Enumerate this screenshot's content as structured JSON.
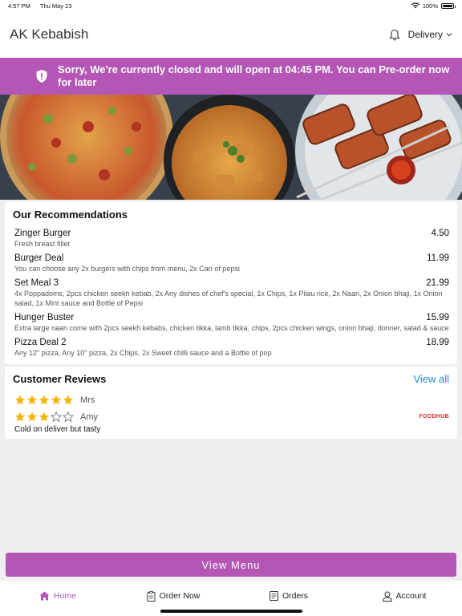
{
  "status_bar": {
    "time": "4:57 PM",
    "date": "Thu May 23",
    "battery": "100%",
    "battery_level": 1.0
  },
  "header": {
    "title": "AK Kebabish",
    "delivery_label": "Delivery"
  },
  "banner": {
    "message": "Sorry, We're currently closed and will open at 04:45 PM. You can Pre-order now for later"
  },
  "recommendations": {
    "title": "Our Recommendations",
    "items": [
      {
        "name": "Zinger Burger",
        "price": "4.50",
        "description": "Fresh breast fillet"
      },
      {
        "name": "Burger Deal",
        "price": "11.99",
        "description": "You can choose any 2x burgers with chips from menu, 2x Can of pepsi"
      },
      {
        "name": "Set Meal 3",
        "price": "21.99",
        "description": "4x Poppadoms, 2pcs chicken seekh kebab, 2x Any dishes of chef's special, 1x Chips, 1x Pilau rice, 2x Naan, 2x Onion bhaji, 1x Onion salad, 1x Mint sauce and Bottle of Pepsi"
      },
      {
        "name": "Hunger Buster",
        "price": "15.99",
        "description": "Extra large naan come with 2pcs seekh kebabs, chicken tikka, lamb tikka, chips, 2pcs chicken wings, onion bhaji, donner, salad & sauce"
      },
      {
        "name": "Pizza Deal 2",
        "price": "18.99",
        "description": "Any 12\" pizza, Any 10\" pizza, 2x Chips, 2x Sweet chilli sauce and a Bottle of pop"
      }
    ]
  },
  "reviews": {
    "title": "Customer Reviews",
    "view_all_label": "View all",
    "items": [
      {
        "reviewer": "Mrs",
        "rating": 5,
        "text": ""
      },
      {
        "reviewer": "Amy",
        "rating": 3,
        "text": "Cold on deliver but tasty",
        "source": "FOODHUB"
      }
    ]
  },
  "view_menu_label": "View Menu",
  "tabs": [
    {
      "label": "Home",
      "icon": "home-icon",
      "active": true
    },
    {
      "label": "Order Now",
      "icon": "clipboard-icon",
      "active": false
    },
    {
      "label": "Orders",
      "icon": "receipt-icon",
      "active": false
    },
    {
      "label": "Account",
      "icon": "user-icon",
      "active": false
    }
  ],
  "colors": {
    "accent": "#b356b5",
    "link": "#1a8fd0",
    "star": "#f5b400",
    "foodhub": "#d62d2d"
  }
}
